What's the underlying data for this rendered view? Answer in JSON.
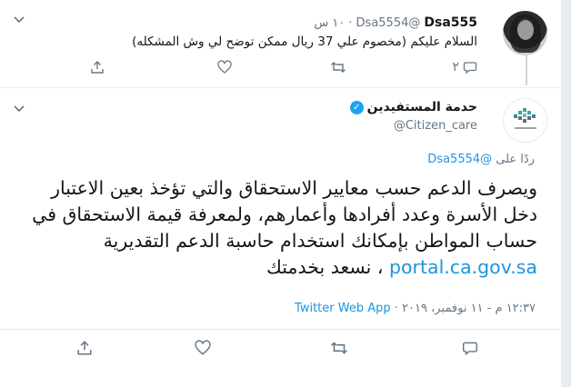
{
  "parent_tweet": {
    "display_name": "Dsa555",
    "handle": "@Dsa5554",
    "time": "١٠ س",
    "text": "السلام عليكم (مخصوم علي 37 ريال ممكن توضح لي وش المشكله)",
    "reply_count": "٢"
  },
  "main_tweet": {
    "display_name": "حدمة المستفيدين",
    "handle": "@Citizen_care",
    "reply_prefix": "ردًا على",
    "reply_to": "@Dsa5554",
    "body_text": "ويصرف الدعم حسب معايير الاستحقاق والتي تؤخذ بعين الاعتبار دخل الأسرة وعدد أفرادها وأعمارهم، ولمعرفة قيمة الاستحقاق في حساب المواطن بإمكانك استخدام حاسبة الدعم التقديرية",
    "link": "portal.ca.gov.sa",
    "body_suffix": "، نسعد بخدمتك",
    "timestamp": "١٢:٣٧ م - ١١ نوفمبر، ٢٠١٩",
    "source": "Twitter Web App",
    "avatar_logo_text": "حساب المواطن"
  },
  "colors": {
    "link": "#1b95e0",
    "muted": "#657786",
    "verified": "#1da1f2",
    "text": "#14171a"
  }
}
